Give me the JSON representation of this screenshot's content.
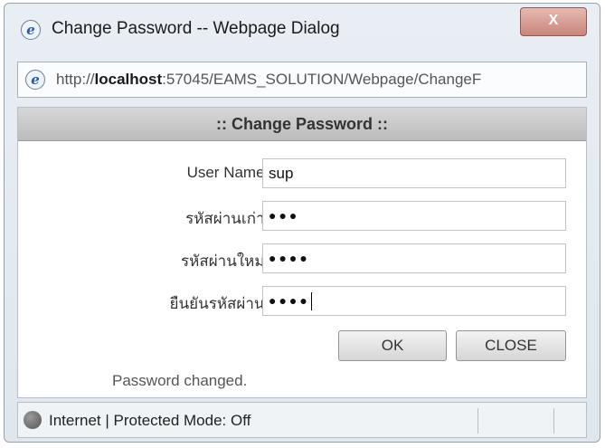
{
  "window": {
    "title": "Change Password -- Webpage Dialog",
    "close_label": "X",
    "url_prefix": "http://",
    "url_host": "localhost",
    "url_rest": ":57045/EAMS_SOLUTION/Webpage/ChangeF"
  },
  "panel": {
    "header": ":: Change Password ::"
  },
  "form": {
    "username_label": "User Name :",
    "username_value": "sup",
    "old_password_label": "รหัสผ่านเก่า :",
    "old_password_value": "●●●",
    "new_password_label": "รหัสผ่านใหม่ :",
    "new_password_value": "●●●●",
    "confirm_password_label": "ยืนยันรหัสผ่าน :",
    "confirm_password_value": "●●●●"
  },
  "buttons": {
    "ok": "OK",
    "close": "CLOSE"
  },
  "status_message": "Password changed.",
  "statusbar": {
    "zone": "Internet | Protected Mode: Off"
  }
}
